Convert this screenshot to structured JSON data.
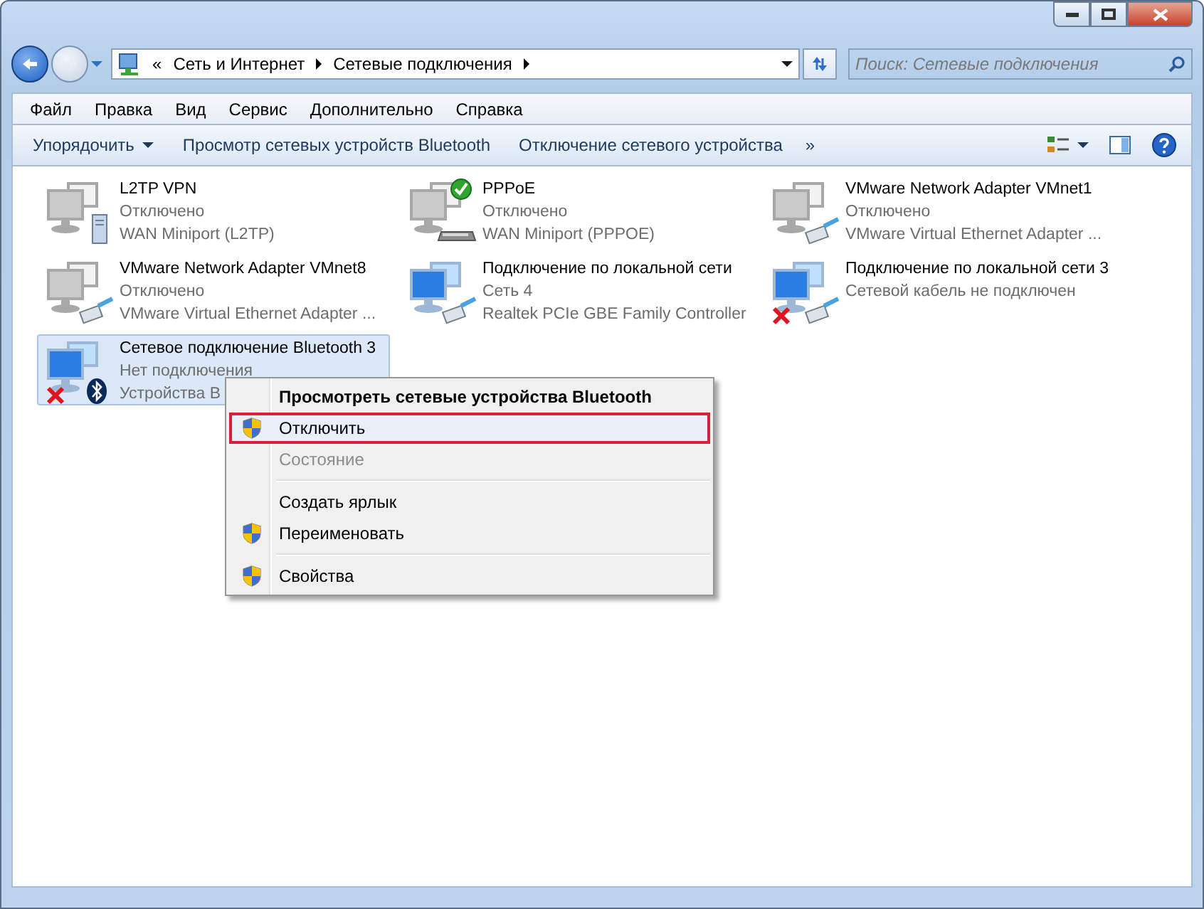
{
  "address_bar": {
    "overflow": "«",
    "segments": [
      "Сеть и Интернет",
      "Сетевые подключения"
    ]
  },
  "search": {
    "placeholder": "Поиск: Сетевые подключения"
  },
  "menu_bar": [
    "Файл",
    "Правка",
    "Вид",
    "Сервис",
    "Дополнительно",
    "Справка"
  ],
  "command_bar": [
    {
      "label": "Упорядочить",
      "dropdown": true
    },
    {
      "label": "Просмотр сетевых устройств Bluetooth",
      "dropdown": false
    },
    {
      "label": "Отключение сетевого устройства",
      "dropdown": false
    }
  ],
  "command_more": "»",
  "connections": [
    {
      "name": "L2TP VPN",
      "status": "Отключено",
      "device": "WAN Miniport (L2TP)",
      "kind": "server",
      "enabled": false,
      "connected": false,
      "error": false,
      "selected": false
    },
    {
      "name": "PPPoE",
      "status": "Отключено",
      "device": "WAN Miniport (PPPOE)",
      "kind": "modem",
      "enabled": false,
      "connected": true,
      "error": false,
      "selected": false
    },
    {
      "name": "VMware Network Adapter VMnet1",
      "status": "Отключено",
      "device": "VMware Virtual Ethernet Adapter ...",
      "kind": "cable",
      "enabled": false,
      "connected": false,
      "error": false,
      "selected": false
    },
    {
      "name": "VMware Network Adapter VMnet8",
      "status": "Отключено",
      "device": "VMware Virtual Ethernet Adapter ...",
      "kind": "cable",
      "enabled": false,
      "connected": false,
      "error": false,
      "selected": false
    },
    {
      "name": "Подключение по локальной сети",
      "status": "Сеть  4",
      "device": "Realtek PCIe GBE Family Controller",
      "kind": "cable",
      "enabled": true,
      "connected": false,
      "error": false,
      "selected": false
    },
    {
      "name": "Подключение по локальной сети 3",
      "status": "Сетевой кабель не подключен",
      "kind": "cable",
      "enabled": true,
      "connected": false,
      "error": true,
      "selected": false
    },
    {
      "name": "Сетевое подключение Bluetooth 3",
      "status": "Нет подключения",
      "device": "Устройства B",
      "kind": "bluetooth",
      "enabled": true,
      "connected": false,
      "error": true,
      "selected": true
    }
  ],
  "context_menu": [
    {
      "kind": "item",
      "label": "Просмотреть сетевые устройства Bluetooth",
      "default": true,
      "disabled": false,
      "shield": false,
      "selected": false
    },
    {
      "kind": "item",
      "label": "Отключить",
      "default": false,
      "disabled": false,
      "shield": true,
      "selected": true
    },
    {
      "kind": "item",
      "label": "Состояние",
      "default": false,
      "disabled": true,
      "shield": false,
      "selected": false
    },
    {
      "kind": "separator"
    },
    {
      "kind": "item",
      "label": "Создать ярлык",
      "default": false,
      "disabled": false,
      "shield": false,
      "selected": false
    },
    {
      "kind": "item",
      "label": "Переименовать",
      "default": false,
      "disabled": false,
      "shield": true,
      "selected": false
    },
    {
      "kind": "separator"
    },
    {
      "kind": "item",
      "label": "Свойства",
      "default": false,
      "disabled": false,
      "shield": true,
      "selected": false
    }
  ]
}
